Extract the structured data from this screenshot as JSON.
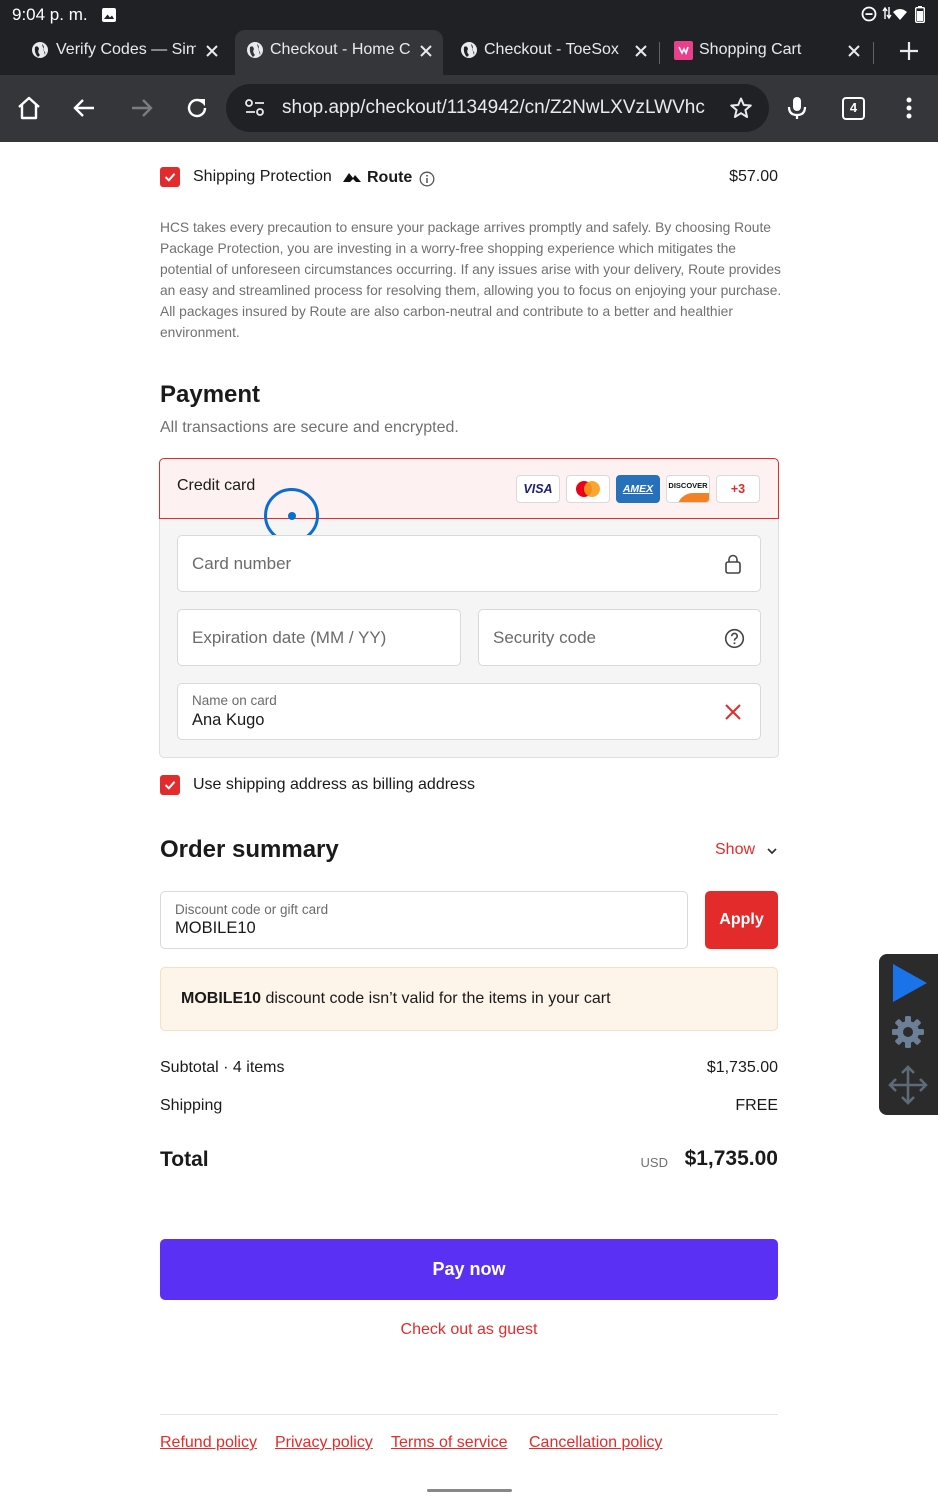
{
  "status_bar": {
    "time": "9:04 p. m."
  },
  "tabs": [
    {
      "title": "Verify Codes — Sim",
      "active": false
    },
    {
      "title": "Checkout - Home C",
      "active": true
    },
    {
      "title": "Checkout - ToeSox",
      "active": false
    },
    {
      "title": "Shopping Cart",
      "active": false
    }
  ],
  "toolbar": {
    "url": "shop.app/checkout/1134942/cn/Z2NwLXVzLWVhc",
    "tab_count": "4"
  },
  "shipping_protection": {
    "label": "Shipping Protection",
    "brand": "Route",
    "price": "$57.00",
    "description": "HCS takes every precaution to ensure your package arrives promptly and safely. By choosing Route Package Protection, you are investing in a worry-free shopping experience which mitigates the potential of unforeseen circumstances occurring. If any issues arise with your delivery, Route provides an easy and streamlined process for resolving them, allowing you to focus on enjoying your purchase. All packages insured by Route are also carbon-neutral and contribute to a better and healthier environment."
  },
  "payment": {
    "heading": "Payment",
    "subtitle": "All transactions are secure and encrypted.",
    "method_label": "Credit card",
    "card_brands": [
      "VISA",
      "AMEX",
      "DISCOVER"
    ],
    "more_brands": "+3",
    "card_number_placeholder": "Card number",
    "expiration_placeholder": "Expiration date (MM / YY)",
    "security_placeholder": "Security code",
    "name_label": "Name on card",
    "name_value": "Ana Kugo",
    "billing_checkbox_label": "Use shipping address as billing address"
  },
  "order_summary": {
    "heading": "Order summary",
    "show_label": "Show",
    "discount_label": "Discount code or gift card",
    "discount_value": "MOBILE10",
    "apply_label": "Apply",
    "error_code": "MOBILE10",
    "error_text": " discount code isn’t valid for the items in your cart",
    "subtotal_label": "Subtotal · 4 items",
    "subtotal_value": "$1,735.00",
    "shipping_label": "Shipping",
    "shipping_value": "FREE",
    "total_label": "Total",
    "total_currency": "USD",
    "total_value": "$1,735.00"
  },
  "actions": {
    "pay_now": "Pay now",
    "guest_checkout": "Check out as guest"
  },
  "footer_links": [
    "Refund policy",
    "Privacy policy",
    "Terms of service",
    "Cancellation policy"
  ],
  "colors": {
    "accent": "#e32b2b",
    "pay_button": "#5a31f4",
    "browser_dark": "#202124"
  }
}
